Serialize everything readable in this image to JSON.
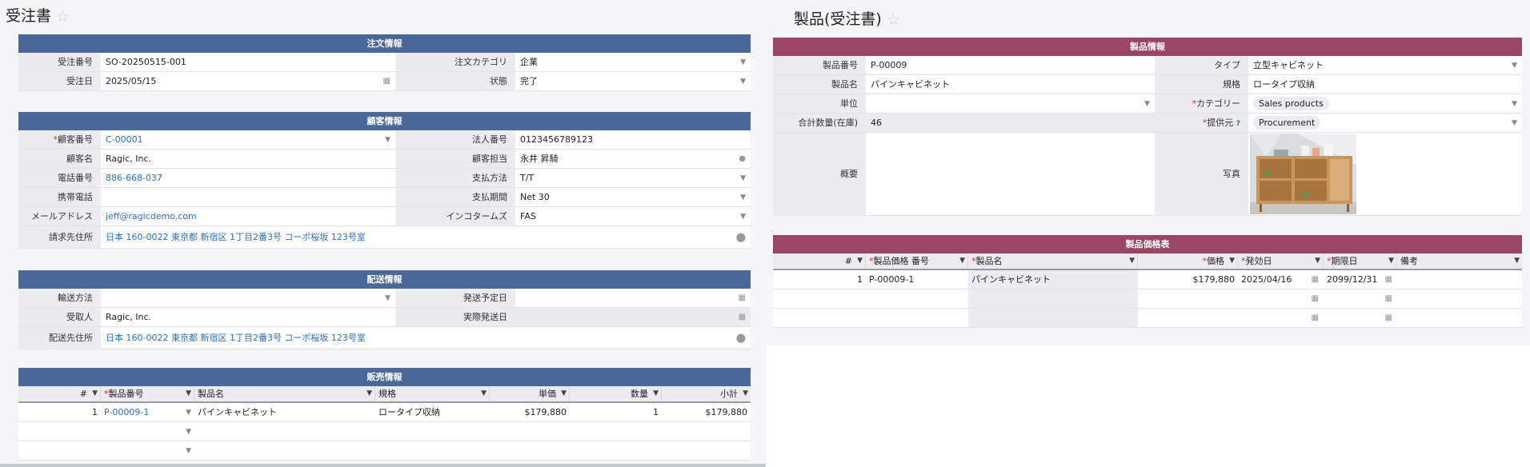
{
  "left": {
    "title": "受注書",
    "order_info": {
      "header": "注文情報",
      "rows": [
        {
          "l1": "受注番号",
          "v1": "SO-20250515-001",
          "l2": "注文カテゴリ",
          "v2": "企業"
        },
        {
          "l1": "受注日",
          "v1": "2025/05/15",
          "l2": "状態",
          "v2": "完了"
        }
      ]
    },
    "customer_info": {
      "header": "顧客情報",
      "rows": [
        {
          "l1_req": "*",
          "l1": "顧客番号",
          "v1": "C-00001",
          "l2": "法人番号",
          "v2": "0123456789123"
        },
        {
          "l1": "顧客名",
          "v1": "Ragic, Inc.",
          "l2": "顧客担当",
          "v2": "永井 昇騎"
        },
        {
          "l1": "電話番号",
          "v1": "886-668-037",
          "l2": "支払方法",
          "v2": "T/T"
        },
        {
          "l1": "携帯電話",
          "v1": "",
          "l2": "支払期間",
          "v2": "Net 30"
        },
        {
          "l1": "メールアドレス",
          "v1": "jeff@ragicdemo.com",
          "l2": "インコタームズ",
          "v2": "FAS"
        }
      ],
      "billing_label": "請求先住所",
      "billing_value": "日本 160-0022 東京都 新宿区 1丁目2番3号 コーポ桜坂 123号室"
    },
    "shipping_info": {
      "header": "配送情報",
      "rows": [
        {
          "l1": "輸送方法",
          "v1": "",
          "l2": "発送予定日",
          "v2": ""
        },
        {
          "l1": "受取人",
          "v1": "Ragic, Inc.",
          "l2": "実際発送日",
          "v2": ""
        }
      ],
      "address_label": "配送先住所",
      "address_value": "日本 160-0022 東京都 新宿区 1丁目2番3号 コーポ桜坂 123号室"
    },
    "sales_info": {
      "header": "販売情報",
      "columns": {
        "num": "#",
        "req": "*",
        "product_no": "製品番号",
        "product_name": "製品名",
        "spec": "規格",
        "unit_price": "単価",
        "qty": "数量",
        "subtotal": "小計"
      },
      "rows": [
        {
          "num": "1",
          "product_no": "P-00009-1",
          "product_name": "パインキャビネット",
          "spec": "ロータイプ収納",
          "unit_price": "$179,880",
          "qty": "1",
          "subtotal": "$179,880"
        }
      ]
    }
  },
  "right": {
    "title": "製品(受注書)",
    "product_info": {
      "header": "製品情報",
      "rows": [
        {
          "l1": "製品番号",
          "v1": "P-00009",
          "l2": "タイプ",
          "v2": "立型キャビネット"
        },
        {
          "l1": "製品名",
          "v1": "パインキャビネット",
          "l2": "規格",
          "v2": "ロータイプ収納"
        }
      ],
      "unit_label": "単位",
      "unit_value": "",
      "category_req": "*",
      "category_label": "カテゴリー",
      "category_value": "Sales products",
      "total_label": "合計数量(在庫)",
      "total_value": "46",
      "supplier_req": "*",
      "supplier_label": "提供元",
      "supplier_help": "?",
      "supplier_value": "Procurement",
      "summary_label": "概要",
      "photo_label": "写真"
    },
    "price_table": {
      "header": "製品価格表",
      "columns": {
        "num": "#",
        "req": "*",
        "price_no": "製品価格 番号",
        "product_name": "製品名",
        "price": "価格",
        "start": "発効日",
        "end": "期限日",
        "note": "備考"
      },
      "rows": [
        {
          "num": "1",
          "price_no": "P-00009-1",
          "product_name": "パインキャビネット",
          "price": "$179,880",
          "start": "2025/04/16",
          "end": "2099/12/31",
          "note": ""
        }
      ]
    }
  },
  "colors": {
    "blue_header": "#4a6899",
    "wine_header": "#9b4564",
    "link": "#2a6fc9",
    "required": "#d9342b"
  }
}
